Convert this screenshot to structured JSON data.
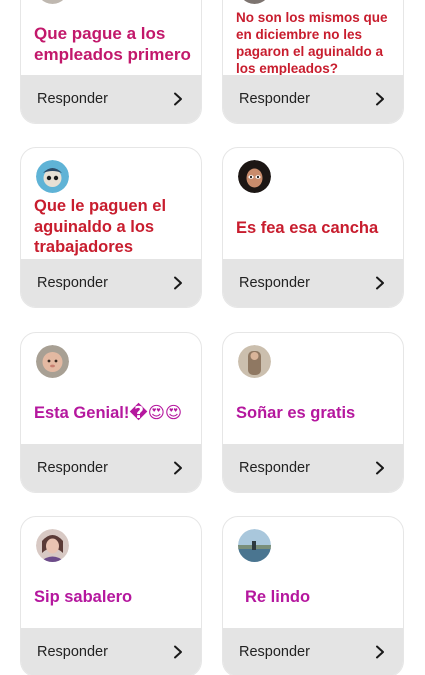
{
  "reply_label": "Responder",
  "icons": {
    "reply": "chevron-right-icon"
  },
  "colors": {
    "magenta": "#c2186b",
    "red": "#c81d2e",
    "reply_bg": "#e4e4e4"
  },
  "cards": [
    {
      "message": "Que pague a los empleados primero",
      "avatar": "avatar-top-left"
    },
    {
      "message": "No son los mismos que en diciembre no les pagaron el aguinaldo a los empleados?",
      "avatar": "avatar-top-right"
    },
    {
      "message": "Que le paguen el aguinaldo a los trabajadores",
      "avatar": "avatar-blue-cartoon"
    },
    {
      "message": "Es fea esa cancha",
      "avatar": "avatar-dark-face"
    },
    {
      "message": "Esta Genial!�😍😍",
      "avatar": "avatar-baby"
    },
    {
      "message": "Soñar es gratis",
      "avatar": "avatar-person-light"
    },
    {
      "message": "Sip sabalero",
      "avatar": "avatar-woman"
    },
    {
      "message": "Re lindo",
      "avatar": "avatar-landscape"
    }
  ]
}
